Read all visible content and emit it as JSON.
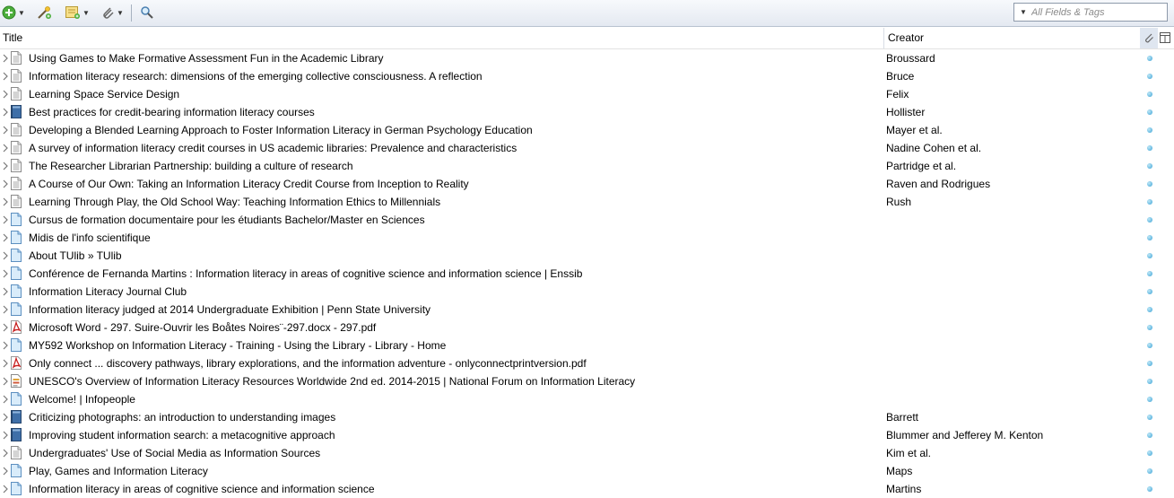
{
  "toolbar": {
    "new_item_icon": "green-plus-circle-icon",
    "add_by_identifier_icon": "magic-wand-icon",
    "new_note_icon": "note-icon",
    "add_attachment_icon": "paperclip-icon",
    "advanced_search_icon": "magnifier-icon",
    "search_placeholder": "All Fields & Tags"
  },
  "columns": {
    "title": "Title",
    "creator": "Creator"
  },
  "colors": {
    "accent": "#3aa3d6",
    "header_bg": "#e4e9f1"
  },
  "items": [
    {
      "title": "Using Games to Make Formative Assessment Fun in the Academic Library",
      "creator": "Broussard",
      "type": "journal-article"
    },
    {
      "title": "Information literacy research: dimensions of the emerging collective consciousness. A reflection",
      "creator": "Bruce",
      "type": "journal-article"
    },
    {
      "title": "Learning Space Service Design",
      "creator": "Felix",
      "type": "journal-article"
    },
    {
      "title": "Best practices for credit-bearing information literacy courses",
      "creator": "Hollister",
      "type": "book"
    },
    {
      "title": "Developing a Blended Learning Approach to Foster Information Literacy in German Psychology Education",
      "creator": "Mayer et al.",
      "type": "journal-article"
    },
    {
      "title": "A survey of information literacy credit courses in US academic libraries: Prevalence and characteristics",
      "creator": "Nadine Cohen et al.",
      "type": "journal-article"
    },
    {
      "title": "The Researcher Librarian Partnership: building a culture of research",
      "creator": "Partridge et al.",
      "type": "journal-article"
    },
    {
      "title": "A Course of Our Own: Taking an Information Literacy Credit Course from Inception to Reality",
      "creator": "Raven and Rodrigues",
      "type": "journal-article"
    },
    {
      "title": "Learning Through Play, the Old School Way: Teaching Information Ethics to Millennials",
      "creator": "Rush",
      "type": "journal-article"
    },
    {
      "title": "Cursus de formation documentaire pour les étudiants Bachelor/Master en Sciences",
      "creator": "",
      "type": "web-page"
    },
    {
      "title": "Midis de l'info scientifique",
      "creator": "",
      "type": "web-page"
    },
    {
      "title": "About TUlib » TUlib",
      "creator": "",
      "type": "web-page"
    },
    {
      "title": "Conférence de Fernanda Martins : Information literacy in areas of cognitive science and information science | Enssib",
      "creator": "",
      "type": "web-page"
    },
    {
      "title": "Information Literacy Journal Club",
      "creator": "",
      "type": "web-page"
    },
    {
      "title": "Information literacy judged at 2014 Undergraduate Exhibition | Penn State University",
      "creator": "",
      "type": "web-page"
    },
    {
      "title": "Microsoft Word - 297. Suire-Ouvrir les Boåtes Noires¨-297.docx - 297.pdf",
      "creator": "",
      "type": "pdf"
    },
    {
      "title": "MY592 Workshop on Information Literacy - Training - Using the Library - Library - Home",
      "creator": "",
      "type": "web-page"
    },
    {
      "title": "Only connect ... discovery pathways, library explorations, and the information adventure - onlyconnectprintversion.pdf",
      "creator": "",
      "type": "pdf"
    },
    {
      "title": "UNESCO's Overview of Information Literacy Resources Worldwide 2nd ed. 2014-2015 | National Forum on Information Literacy",
      "creator": "",
      "type": "report"
    },
    {
      "title": "Welcome! | Infopeople",
      "creator": "",
      "type": "web-page"
    },
    {
      "title": "Criticizing photographs: an introduction to understanding images",
      "creator": "Barrett",
      "type": "book"
    },
    {
      "title": "Improving student information search: a metacognitive approach",
      "creator": "Blummer and Jefferey M. Kenton",
      "type": "book"
    },
    {
      "title": "Undergraduates' Use of Social Media as Information Sources",
      "creator": "Kim et al.",
      "type": "journal-article"
    },
    {
      "title": "Play, Games and Information Literacy",
      "creator": "Maps",
      "type": "web-page"
    },
    {
      "title": "Information literacy in areas of cognitive science and information science",
      "creator": "Martins",
      "type": "web-page"
    }
  ]
}
